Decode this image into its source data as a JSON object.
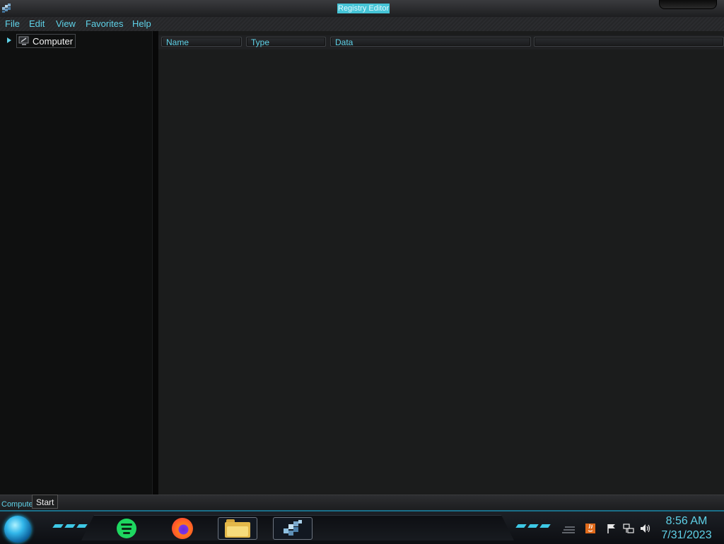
{
  "window": {
    "title": "Registry Editor"
  },
  "menu": [
    "File",
    "Edit",
    "View",
    "Favorites",
    "Help"
  ],
  "tree": {
    "root_label": "Computer",
    "expanded": false
  },
  "list": {
    "columns": [
      "Name",
      "Type",
      "Data",
      ""
    ],
    "rows": []
  },
  "statusbar": {
    "path_text": "Computer"
  },
  "tooltip": {
    "start": "Start"
  },
  "taskbar": {
    "pinned": [
      "spotify-icon",
      "firefox-icon",
      "file-explorer-icon",
      "registry-editor-icon"
    ],
    "active": "registry-editor-icon",
    "tray_icons": [
      "show-hidden-icons",
      "java-update-icon",
      "action-center-flag-icon",
      "network-icon",
      "volume-icon"
    ],
    "clock_time": "8:56 AM",
    "clock_date": "7/31/2023"
  },
  "colors": {
    "accent": "#5fd2e8",
    "window_bg": "#1b1c1c",
    "tree_bg": "#0f1010"
  }
}
